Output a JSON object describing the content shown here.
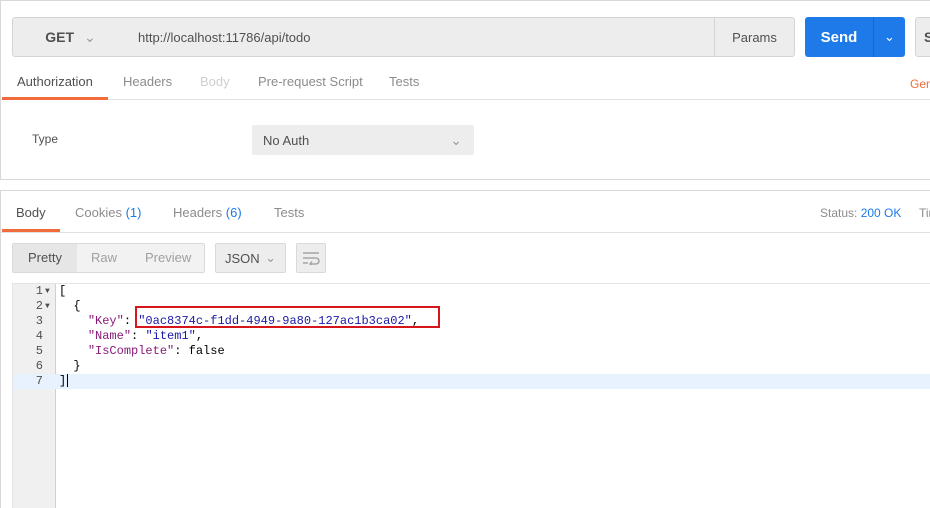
{
  "request": {
    "method": "GET",
    "url": "http://localhost:11786/api/todo",
    "params_label": "Params",
    "send_label": "Send",
    "save_label": "S"
  },
  "request_tabs": {
    "authorization": "Authorization",
    "headers": "Headers",
    "body": "Body",
    "prerequest": "Pre-request Script",
    "tests": "Tests",
    "generate": "Gen"
  },
  "auth": {
    "type_label": "Type",
    "type_value": "No Auth"
  },
  "response_tabs": {
    "body": "Body",
    "cookies": "Cookies",
    "cookies_count": "(1)",
    "headers": "Headers",
    "headers_count": "(6)",
    "tests": "Tests",
    "status_label": "Status:",
    "status_value": "200 OK",
    "time_label": "Tir"
  },
  "view": {
    "pretty": "Pretty",
    "raw": "Raw",
    "preview": "Preview",
    "format": "JSON"
  },
  "code": {
    "line_numbers": [
      "1",
      "2",
      "3",
      "4",
      "5",
      "6",
      "7"
    ],
    "line1": "[",
    "line2": "  {",
    "key_key": "\"Key\"",
    "key_val": "\"0ac8374c-f1dd-4949-9a80-127ac1b3ca02\"",
    "name_key": "\"Name\"",
    "name_val": "\"item1\"",
    "iscomplete_key": "\"IsComplete\"",
    "iscomplete_val": "false",
    "line6": "  }",
    "line7": "]"
  },
  "colors": {
    "accent": "#f26b3a",
    "send_blue": "#1d7ae8",
    "highlight_box": "#d7161b"
  }
}
